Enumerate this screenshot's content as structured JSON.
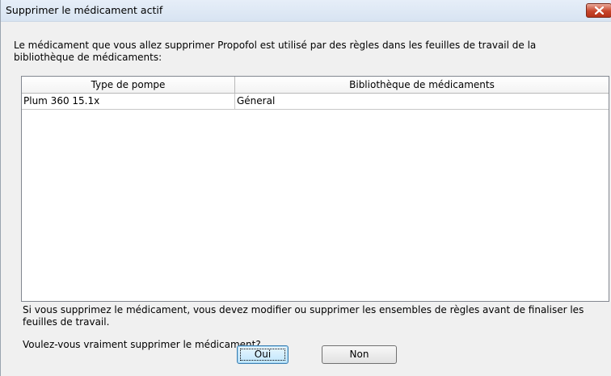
{
  "window": {
    "title": "Supprimer le médicament actif",
    "close_icon": "close-x-icon"
  },
  "message": {
    "text": "Le médicament que vous allez supprimer Propofol est utilisé par des règles dans les feuilles de travail de la bibliothèque de médicaments:"
  },
  "table": {
    "columns": [
      "Type de pompe",
      "Bibliothèque de médicaments"
    ],
    "rows": [
      [
        "Plum 360 15.1x",
        "Géneral"
      ]
    ]
  },
  "warning": {
    "text": "Si vous supprimez le médicament, vous devez modifier ou supprimer les ensembles de règles avant de finaliser les feuilles de travail."
  },
  "confirm": {
    "text": "Voulez-vous vraiment supprimer le médicament?"
  },
  "buttons": {
    "yes_label": "Oui",
    "no_label": "Non"
  },
  "colors": {
    "titlebar": "#dae5f3",
    "close_button": "#c7452b",
    "dialog_background": "#f0f0f0",
    "default_button_border": "#3c7fb1"
  }
}
